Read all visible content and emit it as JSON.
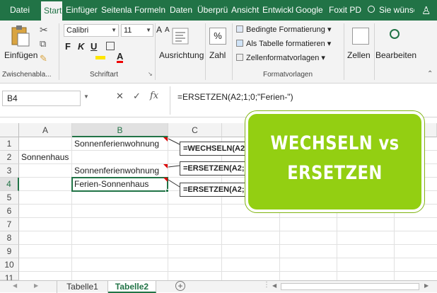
{
  "ribbon_tabs": [
    "Datei",
    "Start",
    "Einfüger",
    "Seitenla",
    "Formeln",
    "Daten",
    "Überprü",
    "Ansicht",
    "Entwickl",
    "Google",
    "Foxit PD",
    "Sie wünsc"
  ],
  "ribbon": {
    "paste_label": "Einfügen",
    "clipboard_group": "Zwischenabla...",
    "font_name": "Calibri",
    "font_size": "11",
    "bold": "F",
    "italic": "K",
    "underline": "U",
    "font_group": "Schriftart",
    "alignment_label": "Ausrichtung",
    "number_label": "Zahl",
    "cf_conditional": "Bedingte Formatierung",
    "cf_table": "Als Tabelle formatieren",
    "cf_cellstyles": "Zellenformatvorlagen",
    "styles_group": "Formatvorlagen",
    "cells_label": "Zellen",
    "edit_label": "Bearbeiten"
  },
  "formula_bar": {
    "name_box": "B4",
    "cancel": "✕",
    "enter": "✓",
    "fx": "fx",
    "formula": "=ERSETZEN(A2;1;0;\"Ferien-\")"
  },
  "columns": [
    "A",
    "B",
    "C"
  ],
  "rows": [
    "1",
    "2",
    "3",
    "4",
    "5",
    "6",
    "7",
    "8",
    "9",
    "10",
    "11"
  ],
  "cells": {
    "B1": "Sonnenferienwohnung",
    "A2": "Sonnenhaus",
    "B3": "Sonnenferienwohnung",
    "B4": "Ferien-Sonnenhaus"
  },
  "callouts": [
    "=WECHSELN(A2",
    "=ERSETZEN(A2;",
    "=ERSETZEN(A2;"
  ],
  "banner": {
    "line1": "WECHSELN vs",
    "line2": "ERSETZEN"
  },
  "sheet_tabs": [
    "Tabelle1",
    "Tabelle2"
  ],
  "active_sheet": "Tabelle2",
  "colors": {
    "excel_green": "#217346",
    "banner_green": "#93cf12",
    "comment_red": "#dd0000"
  }
}
